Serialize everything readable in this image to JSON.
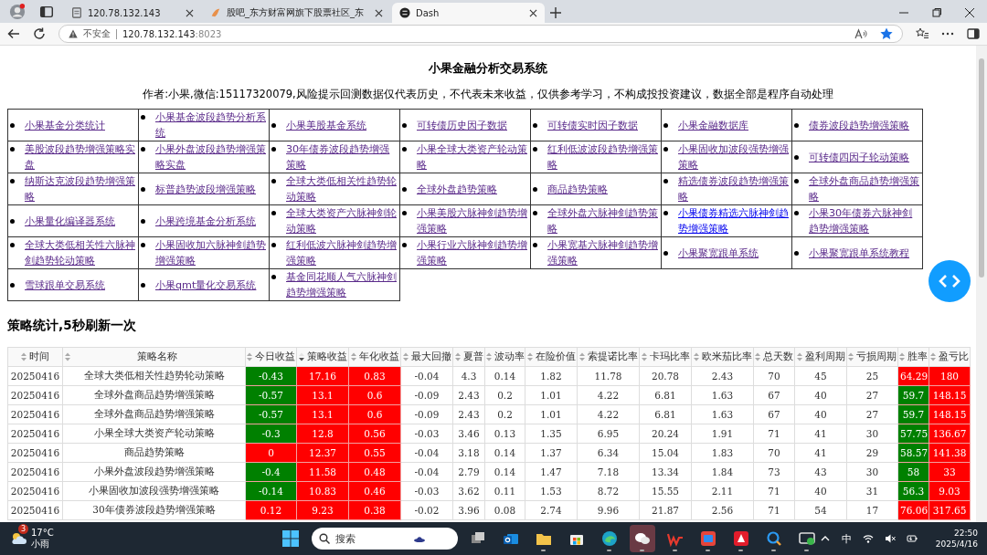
{
  "browser": {
    "tabs": [
      {
        "title": "120.78.132.143",
        "selected": false,
        "kind": "page"
      },
      {
        "title": "股吧_东方财富网旗下股票社区_东",
        "selected": false,
        "kind": "guba"
      },
      {
        "title": "Dash",
        "selected": true,
        "kind": "dash"
      }
    ],
    "address": {
      "security": "不安全",
      "host": "120.78.132.143",
      "port": ":8023"
    }
  },
  "page": {
    "title": "小果金融分析交易系统",
    "subtitle": "作者:小果,微信:15117320079,风险提示回测数据仅代表历史，不代表未来收益，仅供参考学习，不构成投投资建议，数据全部是程序自动处理",
    "links": [
      [
        {
          "label": "小果基金分类统计",
          "visited": true
        },
        {
          "label": "小果基金波段趋势分析系统",
          "visited": true
        },
        {
          "label": "小果美股基金系统",
          "visited": true
        },
        {
          "label": "可转债历史因子数据",
          "visited": true
        },
        {
          "label": "可转债实时因子数据",
          "visited": true
        },
        {
          "label": "小果金融数据库",
          "visited": true
        },
        {
          "label": "债券波段趋势增强策略",
          "visited": true
        }
      ],
      [
        {
          "label": "美股波段趋势增强策略实盘",
          "visited": true
        },
        {
          "label": "小果外盘波段趋势增强策略实盘",
          "visited": true
        },
        {
          "label": "30年债券波段趋势增强策略",
          "visited": true
        },
        {
          "label": "小果全球大类资产轮动策略",
          "visited": true
        },
        {
          "label": "红利低波波段趋势增强策略",
          "visited": true
        },
        {
          "label": "小果固收加波段强势增强策略",
          "visited": true
        },
        {
          "label": "可转债四因子轮动策略",
          "visited": true
        }
      ],
      [
        {
          "label": "纳斯达克波段趋势增强策略",
          "visited": true
        },
        {
          "label": "标普趋势波段增强策略",
          "visited": true
        },
        {
          "label": "全球大类低相关性趋势轮动策略",
          "visited": true
        },
        {
          "label": "全球外盘趋势策略",
          "visited": true
        },
        {
          "label": "商品趋势策略",
          "visited": true
        },
        {
          "label": "精选债券波段趋势增强策略",
          "visited": true
        },
        {
          "label": "全球外盘商品趋势增强策略",
          "visited": true
        }
      ],
      [
        {
          "label": "小果量化编译器系统",
          "visited": true
        },
        {
          "label": "小果跨境基金分析系统",
          "visited": true
        },
        {
          "label": "全球大类资产六脉神剑轮动策略",
          "visited": true
        },
        {
          "label": "小果美股六脉神剑趋势增强策略",
          "visited": true
        },
        {
          "label": "全球外盘六脉神剑趋势策略",
          "visited": true
        },
        {
          "label": "小果债券精选六脉神剑趋势增强策略",
          "visited": false
        },
        {
          "label": "小果30年债券六脉神剑趋势增强策略",
          "visited": true
        }
      ],
      [
        {
          "label": "全球大类低相关性六脉神剑趋势轮动策略",
          "visited": true
        },
        {
          "label": "小果固收加六脉神剑趋势增强策略",
          "visited": true
        },
        {
          "label": "红利低波六脉神剑趋势增强策略",
          "visited": true
        },
        {
          "label": "小果行业六脉神剑趋势增强策略",
          "visited": true
        },
        {
          "label": "小果宽基六脉神剑趋势增强策略",
          "visited": true
        },
        {
          "label": "小果聚宽跟单系统",
          "visited": true
        },
        {
          "label": "小果聚宽跟单系统教程",
          "visited": true
        }
      ],
      [
        {
          "label": "雪球跟单交易系统",
          "visited": true
        },
        {
          "label": "小果qmt量化交易系统",
          "visited": true
        },
        {
          "label": "基金同花顺人气六脉神剑趋势增强策略",
          "visited": true
        }
      ]
    ],
    "stats_heading": "策略统计,5秒刷新一次",
    "table": {
      "columns": [
        {
          "label": "时间",
          "sorted": false
        },
        {
          "label": "策略名称",
          "sorted": false
        },
        {
          "label": "今日收益",
          "sorted": false
        },
        {
          "label": "策略收益",
          "sorted": true
        },
        {
          "label": "年化收益",
          "sorted": false
        },
        {
          "label": "最大回撤",
          "sorted": false
        },
        {
          "label": "夏普",
          "sorted": false
        },
        {
          "label": "波动率",
          "sorted": false
        },
        {
          "label": "在险价值",
          "sorted": false
        },
        {
          "label": "索提诺比率",
          "sorted": false
        },
        {
          "label": "卡玛比率",
          "sorted": false
        },
        {
          "label": "欧米茄比率",
          "sorted": false
        },
        {
          "label": "总天数",
          "sorted": false
        },
        {
          "label": "盈利周期",
          "sorted": false
        },
        {
          "label": "亏损周期",
          "sorted": false
        },
        {
          "label": "胜率",
          "sorted": false
        },
        {
          "label": "盈亏比",
          "sorted": false
        }
      ],
      "rows": [
        [
          "20250416",
          "全球大类低相关性趋势轮动策略",
          {
            "text": "-0.43",
            "color": "#008000"
          },
          {
            "text": "17.16",
            "color": "#ff0000"
          },
          {
            "text": "0.83",
            "color": "#ff0000"
          },
          "-0.04",
          "4.3",
          "0.14",
          "1.82",
          "11.78",
          "20.78",
          "2.43",
          "70",
          "45",
          "25",
          {
            "text": "64.29",
            "color": "#ff0000"
          },
          {
            "text": "180",
            "color": "#ff0000"
          }
        ],
        [
          "20250416",
          "全球外盘商品趋势增强策略",
          {
            "text": "-0.57",
            "color": "#008000"
          },
          {
            "text": "13.1",
            "color": "#ff0000"
          },
          {
            "text": "0.6",
            "color": "#ff0000"
          },
          "-0.09",
          "2.43",
          "0.2",
          "1.01",
          "4.22",
          "6.81",
          "1.63",
          "67",
          "40",
          "27",
          {
            "text": "59.7",
            "color": "#008000"
          },
          {
            "text": "148.15",
            "color": "#ff0000"
          }
        ],
        [
          "20250416",
          "全球外盘商品趋势增强策略",
          {
            "text": "-0.57",
            "color": "#008000"
          },
          {
            "text": "13.1",
            "color": "#ff0000"
          },
          {
            "text": "0.6",
            "color": "#ff0000"
          },
          "-0.09",
          "2.43",
          "0.2",
          "1.01",
          "4.22",
          "6.81",
          "1.63",
          "67",
          "40",
          "27",
          {
            "text": "59.7",
            "color": "#008000"
          },
          {
            "text": "148.15",
            "color": "#ff0000"
          }
        ],
        [
          "20250416",
          "小果全球大类资产轮动策略",
          {
            "text": "-0.3",
            "color": "#008000"
          },
          {
            "text": "12.8",
            "color": "#ff0000"
          },
          {
            "text": "0.56",
            "color": "#ff0000"
          },
          "-0.03",
          "3.46",
          "0.13",
          "1.35",
          "6.95",
          "20.24",
          "1.91",
          "71",
          "41",
          "30",
          {
            "text": "57.75",
            "color": "#008000"
          },
          {
            "text": "136.67",
            "color": "#ff0000"
          }
        ],
        [
          "20250416",
          "商品趋势策略",
          {
            "text": "0",
            "color": "#ff0000"
          },
          {
            "text": "12.37",
            "color": "#ff0000"
          },
          {
            "text": "0.55",
            "color": "#ff0000"
          },
          "-0.04",
          "3.18",
          "0.14",
          "1.37",
          "6.34",
          "15.04",
          "1.83",
          "70",
          "41",
          "29",
          {
            "text": "58.57",
            "color": "#008000"
          },
          {
            "text": "141.38",
            "color": "#ff0000"
          }
        ],
        [
          "20250416",
          "小果外盘波段趋势增强策略",
          {
            "text": "-0.4",
            "color": "#008000"
          },
          {
            "text": "11.58",
            "color": "#ff0000"
          },
          {
            "text": "0.48",
            "color": "#ff0000"
          },
          "-0.04",
          "2.79",
          "0.14",
          "1.47",
          "7.18",
          "13.34",
          "1.84",
          "73",
          "43",
          "30",
          {
            "text": "58",
            "color": "#008000"
          },
          {
            "text": "33",
            "color": "#ff0000"
          }
        ],
        [
          "20250416",
          "小果固收加波段强势增强策略",
          {
            "text": "-0.14",
            "color": "#008000"
          },
          {
            "text": "10.83",
            "color": "#ff0000"
          },
          {
            "text": "0.46",
            "color": "#ff0000"
          },
          "-0.03",
          "3.62",
          "0.11",
          "1.53",
          "8.72",
          "15.55",
          "2.11",
          "71",
          "40",
          "31",
          {
            "text": "56.3",
            "color": "#008000"
          },
          {
            "text": "9.03",
            "color": "#ff0000"
          }
        ],
        [
          "20250416",
          "30年债券波段趋势增强策略",
          {
            "text": "0.12",
            "color": "#ff0000"
          },
          {
            "text": "9.23",
            "color": "#ff0000"
          },
          {
            "text": "0.38",
            "color": "#ff0000"
          },
          "-0.02",
          "3.96",
          "0.08",
          "2.74",
          "9.96",
          "21.87",
          "2.56",
          "71",
          "54",
          "17",
          {
            "text": "76.06",
            "color": "#ff0000"
          },
          {
            "text": "317.65",
            "color": "#ff0000"
          }
        ]
      ]
    }
  },
  "taskbar": {
    "weather": {
      "badge": "3",
      "temperature": "17°C",
      "condition": "小雨"
    },
    "search_placeholder": "搜索",
    "apps": [
      {
        "kind": "taskview",
        "running": false,
        "active": false
      },
      {
        "kind": "mail",
        "running": false,
        "active": false
      },
      {
        "kind": "folder",
        "running": true,
        "active": false
      },
      {
        "kind": "store",
        "running": false,
        "active": false
      },
      {
        "kind": "browser",
        "running": true,
        "active": false
      },
      {
        "kind": "chat",
        "running": true,
        "active": true
      },
      {
        "kind": "office",
        "running": true,
        "active": false
      },
      {
        "kind": "tile",
        "running": true,
        "active": false
      },
      {
        "kind": "redapp",
        "running": true,
        "active": false
      },
      {
        "kind": "lens",
        "running": true,
        "active": false
      },
      {
        "kind": "screen",
        "running": true,
        "active": false
      }
    ],
    "ime": "中",
    "time": "22:50",
    "date": "2025/4/16"
  }
}
